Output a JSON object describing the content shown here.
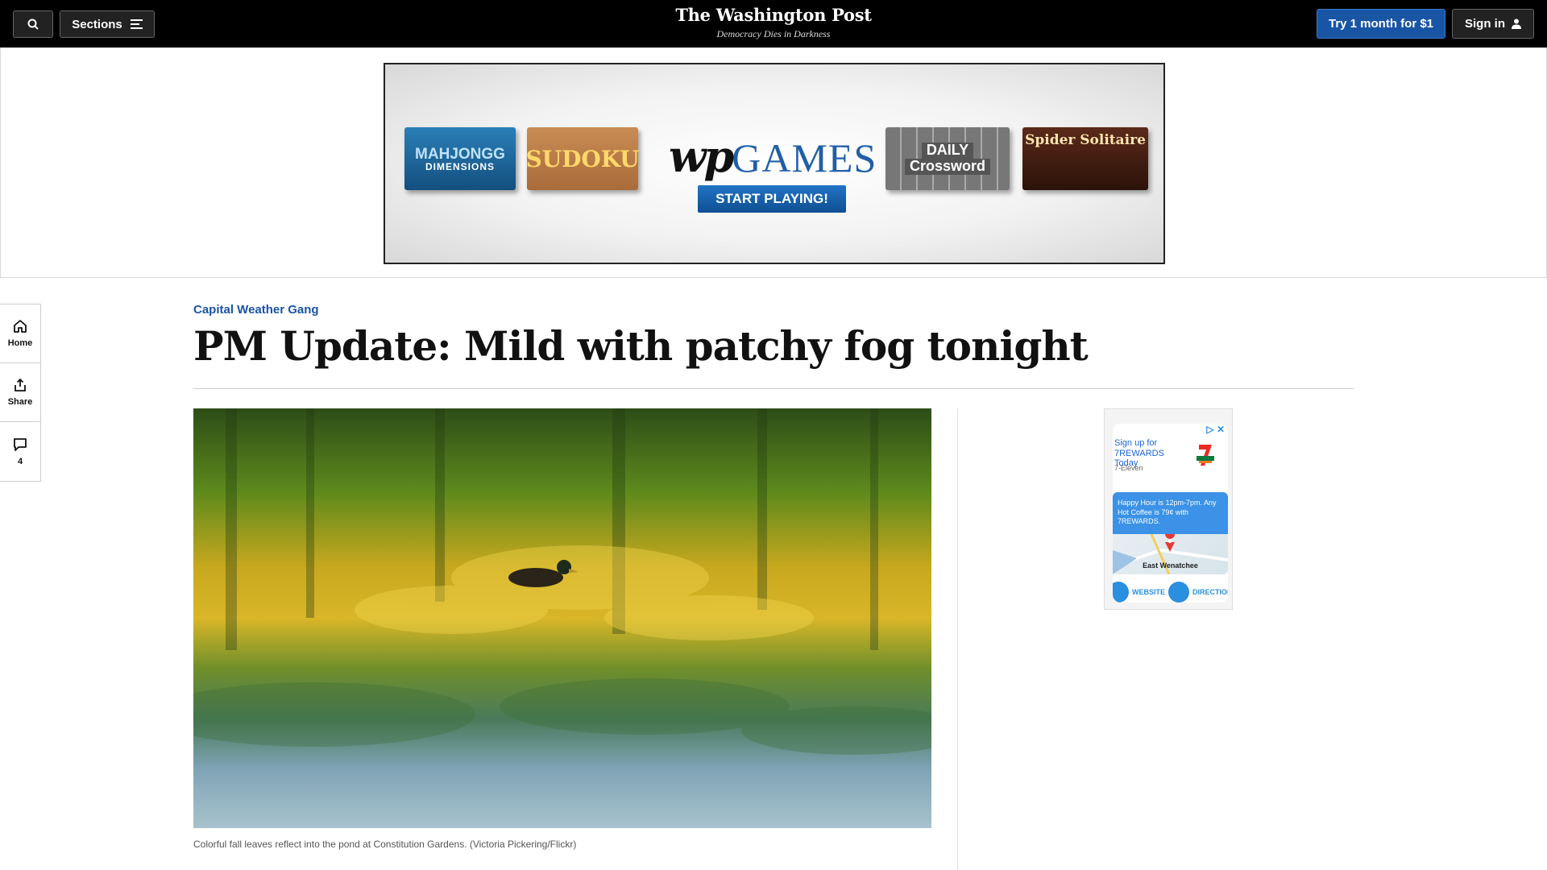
{
  "topbar": {
    "sections_label": "Sections",
    "logo_name": "The Washington Post",
    "logo_tagline": "Democracy Dies in Darkness",
    "trial_label": "Try 1 month for $1",
    "signin_label": "Sign in"
  },
  "banner_ad": {
    "tile_mahjong_top": "MAHJONGG",
    "tile_mahjong_bottom": "DIMENSIONS",
    "tile_sudoku": "SUDOKU",
    "logo_wp": "wp",
    "logo_games": "GAMES",
    "cta": "START PLAYING!",
    "tile_cross_top": "DAILY",
    "tile_cross_bottom": "Crossword",
    "tile_spider": "Spider Solitaire"
  },
  "rail": {
    "home_label": "Home",
    "share_label": "Share",
    "comments_count": "4"
  },
  "article": {
    "kicker": "Capital Weather Gang",
    "headline": "PM Update: Mild with patchy fog tonight",
    "caption": "Colorful fall leaves reflect into the pond at Constitution Gardens. (Victoria Pickering/Flickr)"
  },
  "side_ad": {
    "title": "Sign up for 7REWARDS Today",
    "brand": "7-Eleven",
    "offer": "Happy Hour is 12pm-7pm. Any Hot Coffee is 79¢ with 7REWARDS.",
    "map_label": "East Wenatchee",
    "website_label": "WEBSITE",
    "directions_label": "DIRECTIONS"
  },
  "colors": {
    "accent_blue": "#1955a5",
    "topbar_bg": "#000000"
  }
}
